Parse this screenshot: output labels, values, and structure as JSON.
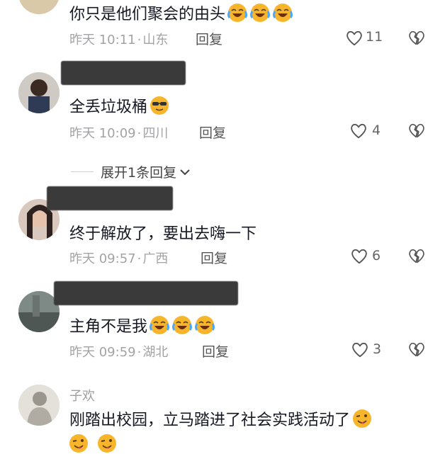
{
  "comments": [
    {
      "text": "你只是他们聚会的由头",
      "time": "昨天 10:11",
      "location": "山东",
      "reply": "回复",
      "likes": "11"
    },
    {
      "text": "全丢垃圾桶",
      "time": "昨天 10:09",
      "location": "四川",
      "reply": "回复",
      "likes": "4"
    },
    {
      "text": "终于解放了，要出去嗨一下",
      "time": "昨天 09:57",
      "location": "广西",
      "reply": "回复",
      "likes": "6"
    },
    {
      "text": "主角不是我",
      "time": "昨天 09:59",
      "location": "湖北",
      "reply": "回复",
      "likes": "3"
    },
    {
      "name": "子欢",
      "text": "刚踏出校园，立马踏进了社会实践活动了"
    }
  ],
  "expand_replies": "展开1条回复",
  "icons": {
    "like": "heart-outline-icon",
    "dislike": "broken-heart-icon",
    "emoji_laugh": "laughing-crying-emoji",
    "emoji_sunglasses": "sunglasses-emoji",
    "emoji_wink": "wink-tongue-emoji",
    "chevron": "chevron-down-icon"
  },
  "colors": {
    "meta": "#a3a3a6",
    "text": "#161823",
    "emoji": "#f7b52c"
  }
}
